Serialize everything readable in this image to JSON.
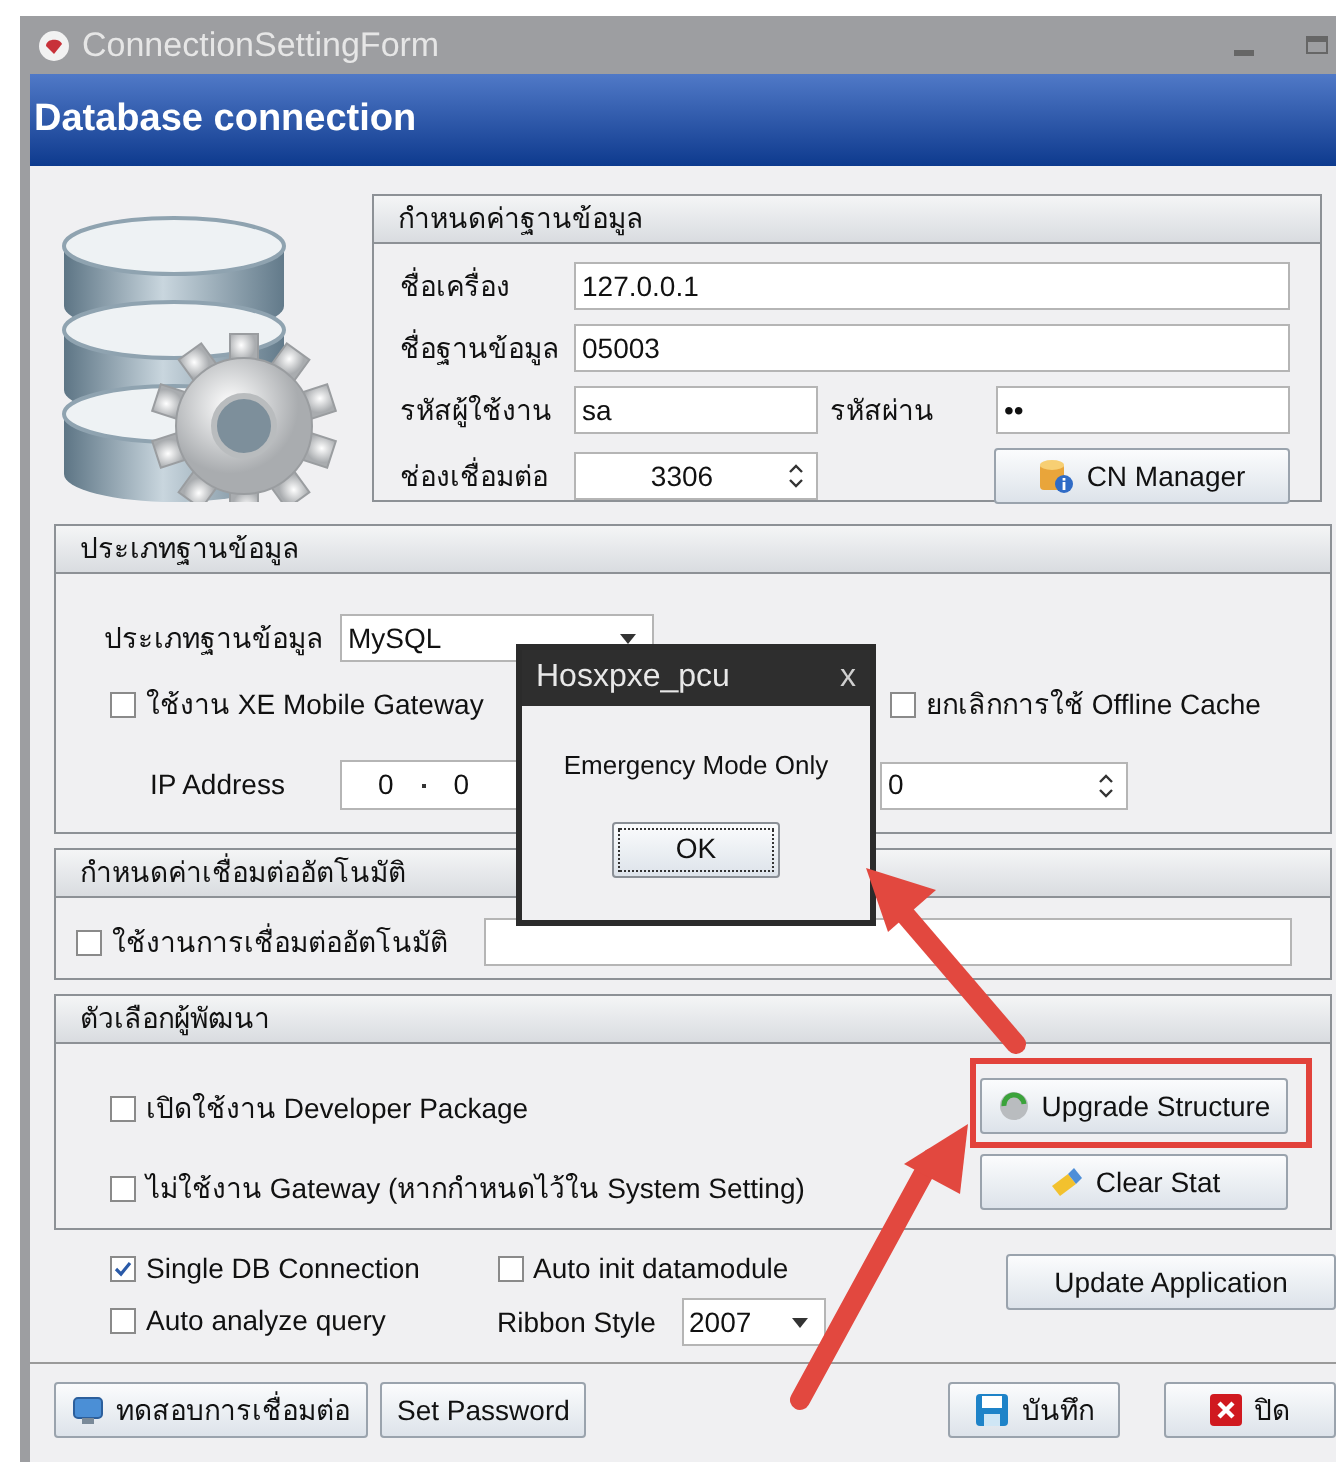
{
  "window": {
    "title": "ConnectionSettingForm"
  },
  "header": {
    "title": "Database connection"
  },
  "database_settings": {
    "title": "กำหนดค่าฐานข้อมูล",
    "host": {
      "label": "ชื่อเครื่อง",
      "value": "127.0.0.1"
    },
    "database": {
      "label": "ชื่อฐานข้อมูล",
      "value": "05003"
    },
    "user": {
      "label": "รหัสผู้ใช้งาน",
      "value": "sa"
    },
    "password": {
      "label": "รหัสผ่าน",
      "value": "••"
    },
    "port": {
      "label": "ช่องเชื่อมต่อ",
      "value": "3306"
    },
    "cn_manager_button": "CN Manager"
  },
  "database_type": {
    "title": "ประเภทฐานข้อมูล",
    "type": {
      "label": "ประเภทฐานข้อมูล",
      "value": "MySQL"
    },
    "checkboxes": [
      {
        "label": "ใช้งาน XE Mobile Gateway",
        "checked": false
      },
      {
        "label": "ยกเลิกการใช้ Offline Cache",
        "checked": false
      }
    ],
    "ip_address": {
      "label": "IP Address",
      "parts": [
        "0",
        "0"
      ]
    },
    "port_value": "0"
  },
  "auto_connect": {
    "title": "กำหนดค่าเชื่อมต่ออัตโนมัติ",
    "checkbox": {
      "label": "ใช้งานการเชื่อมต่ออัตโนมัติ",
      "checked": false
    }
  },
  "developer_options": {
    "title": "ตัวเลือกผู้พัฒนา",
    "checkboxes": [
      {
        "label": "เปิดใช้งาน Developer Package",
        "checked": false
      },
      {
        "label": "ไม่ใช้งาน Gateway (หากกำหนดไว้ใน System Setting)",
        "checked": false
      }
    ],
    "buttons": [
      "Upgrade Structure",
      "Clear Stat"
    ]
  },
  "options": {
    "checkboxes": [
      {
        "label": "Single DB Connection",
        "checked": true
      },
      {
        "label": "Auto analyze query",
        "checked": false
      },
      {
        "label": "Auto init datamodule",
        "checked": false
      }
    ],
    "ribbon_style": {
      "label": "Ribbon Style",
      "value": "2007"
    },
    "update_button": "Update Application"
  },
  "footer": {
    "buttons": [
      "ทดสอบการเชื่อมต่อ",
      "Set Password",
      "บันทึก",
      "ปิด"
    ]
  },
  "dialog": {
    "title": "Hosxpxe_pcu",
    "close": "x",
    "message": "Emergency Mode Only",
    "button": "OK"
  }
}
